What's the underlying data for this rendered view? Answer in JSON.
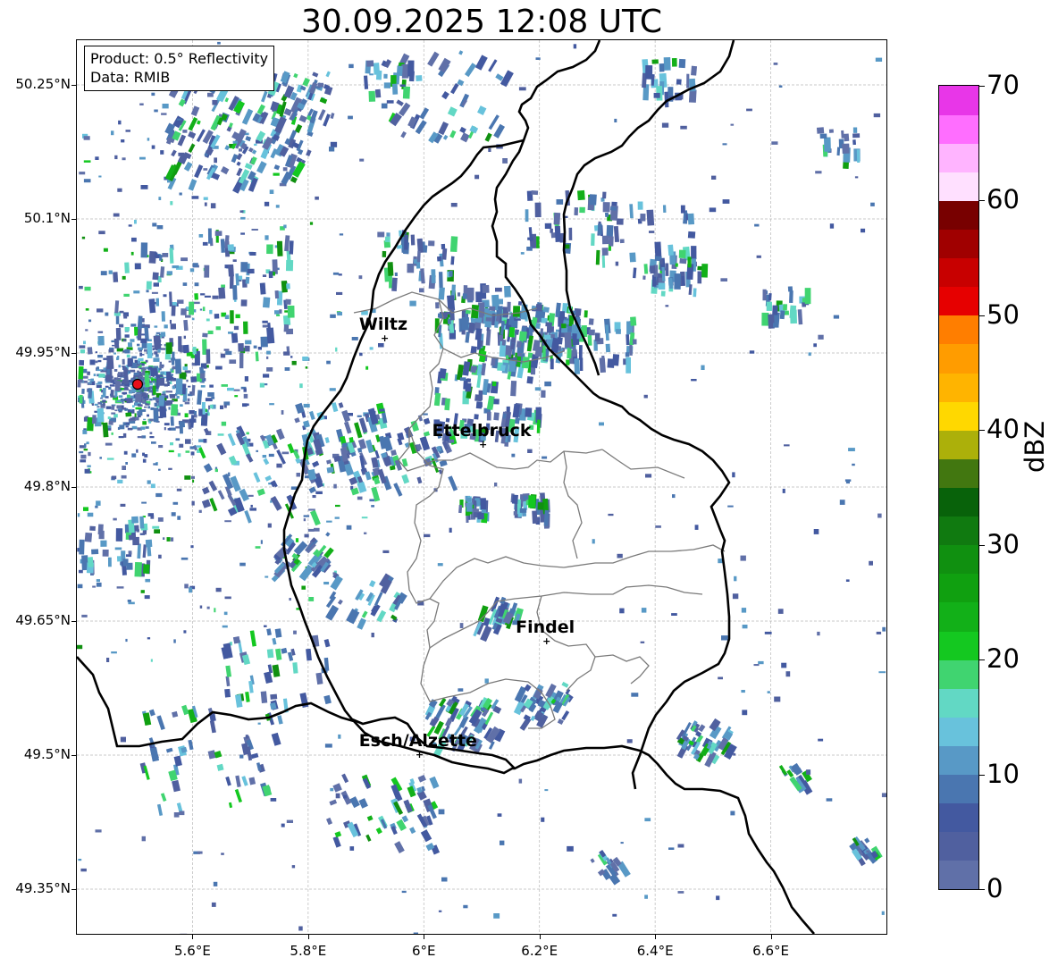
{
  "title": "30.09.2025 12:08 UTC",
  "info_box": {
    "product": "Product: 0.5° Reflectivity",
    "data_source": "Data: RMIB"
  },
  "map": {
    "lon_range": [
      5.4,
      6.8
    ],
    "lat_range": [
      49.3,
      50.3
    ],
    "gridlines": true,
    "lat_ticks": [
      {
        "value": 50.25,
        "label": "50.25°N"
      },
      {
        "value": 50.1,
        "label": "50.1°N"
      },
      {
        "value": 49.95,
        "label": "49.95°N"
      },
      {
        "value": 49.8,
        "label": "49.8°N"
      },
      {
        "value": 49.65,
        "label": "49.65°N"
      },
      {
        "value": 49.5,
        "label": "49.5°N"
      },
      {
        "value": 49.35,
        "label": "49.35°N"
      }
    ],
    "lon_ticks": [
      {
        "value": 5.6,
        "label": "5.6°E"
      },
      {
        "value": 5.8,
        "label": "5.8°E"
      },
      {
        "value": 6.0,
        "label": "6°E"
      },
      {
        "value": 6.2,
        "label": "6.2°E"
      },
      {
        "value": 6.4,
        "label": "6.4°E"
      },
      {
        "value": 6.6,
        "label": "6.6°E"
      }
    ],
    "radar_site": {
      "lon": 5.505,
      "lat": 49.915,
      "color": "#e8101a"
    },
    "cities": [
      {
        "name": "Wiltz",
        "lon": 5.93,
        "lat": 49.966
      },
      {
        "name": "Ettelbruck",
        "lon": 6.1,
        "lat": 49.847
      },
      {
        "name": "Findel",
        "lon": 6.21,
        "lat": 49.627
      },
      {
        "name": "Esch/Alzette",
        "lon": 5.99,
        "lat": 49.5
      }
    ]
  },
  "colorbar": {
    "label": "dBZ",
    "min": 0,
    "max": 70,
    "ticks": [
      {
        "value": 0,
        "label": "0"
      },
      {
        "value": 10,
        "label": "10"
      },
      {
        "value": 20,
        "label": "20"
      },
      {
        "value": 30,
        "label": "30"
      },
      {
        "value": 40,
        "label": "40"
      },
      {
        "value": 50,
        "label": "50"
      },
      {
        "value": 60,
        "label": "60"
      },
      {
        "value": 70,
        "label": "70"
      }
    ],
    "colors": [
      "#6070a8",
      "#50609f",
      "#4359a0",
      "#4a76b0",
      "#5899c6",
      "#68c2dc",
      "#62d8c4",
      "#40d470",
      "#14c820",
      "#12b018",
      "#10a010",
      "#109010",
      "#107a10",
      "#08620a",
      "#427710",
      "#acb00a",
      "#ffd800",
      "#ffb400",
      "#ff9c00",
      "#ff7e00",
      "#e60000",
      "#c80000",
      "#a00000",
      "#780000",
      "#ffe0ff",
      "#ffb4ff",
      "#ff6eff",
      "#e836e8"
    ]
  }
}
